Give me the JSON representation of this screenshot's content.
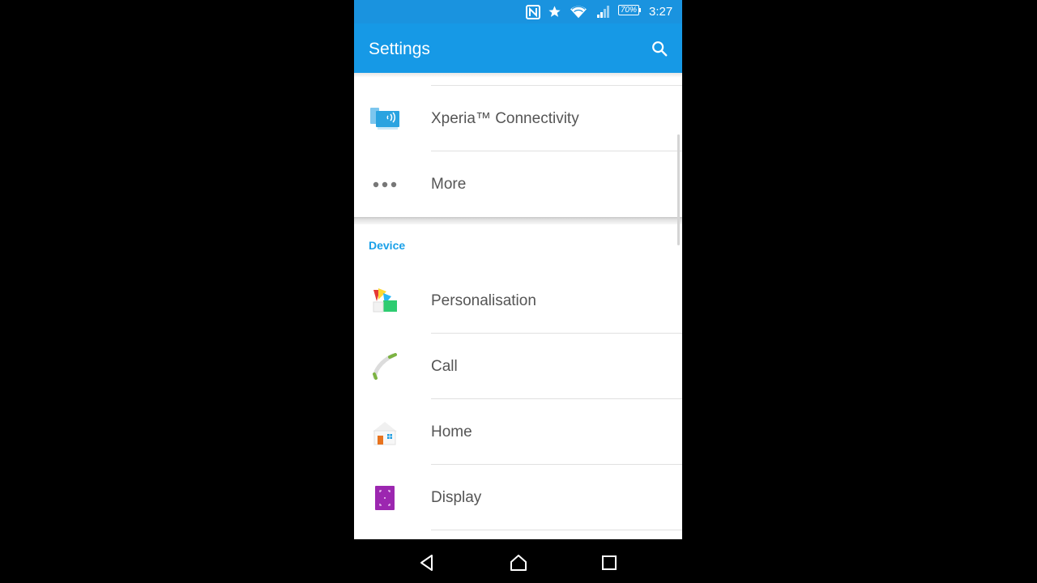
{
  "status_bar": {
    "icons": [
      "nfc-icon",
      "star-icon",
      "wifi-icon",
      "signal-icon"
    ],
    "battery": "70%",
    "time": "3:27"
  },
  "app_bar": {
    "title": "Settings",
    "search_icon": "search-icon"
  },
  "list": {
    "rows_top": [
      {
        "label": "Xperia™ Connectivity",
        "icon": "xperia-connectivity-icon"
      },
      {
        "label": "More",
        "icon": "more-dots-icon"
      }
    ],
    "section": "Device",
    "rows_device": [
      {
        "label": "Personalisation",
        "icon": "personalisation-icon"
      },
      {
        "label": "Call",
        "icon": "call-icon"
      },
      {
        "label": "Home",
        "icon": "home-icon"
      },
      {
        "label": "Display",
        "icon": "display-icon"
      }
    ]
  },
  "nav_bar": {
    "buttons": [
      "back-icon",
      "home-nav-icon",
      "recents-icon"
    ]
  },
  "colors": {
    "status_bar": "#1a93df",
    "app_bar": "#1699e6",
    "section_header": "#1aa0e8",
    "label_text": "#555555"
  }
}
